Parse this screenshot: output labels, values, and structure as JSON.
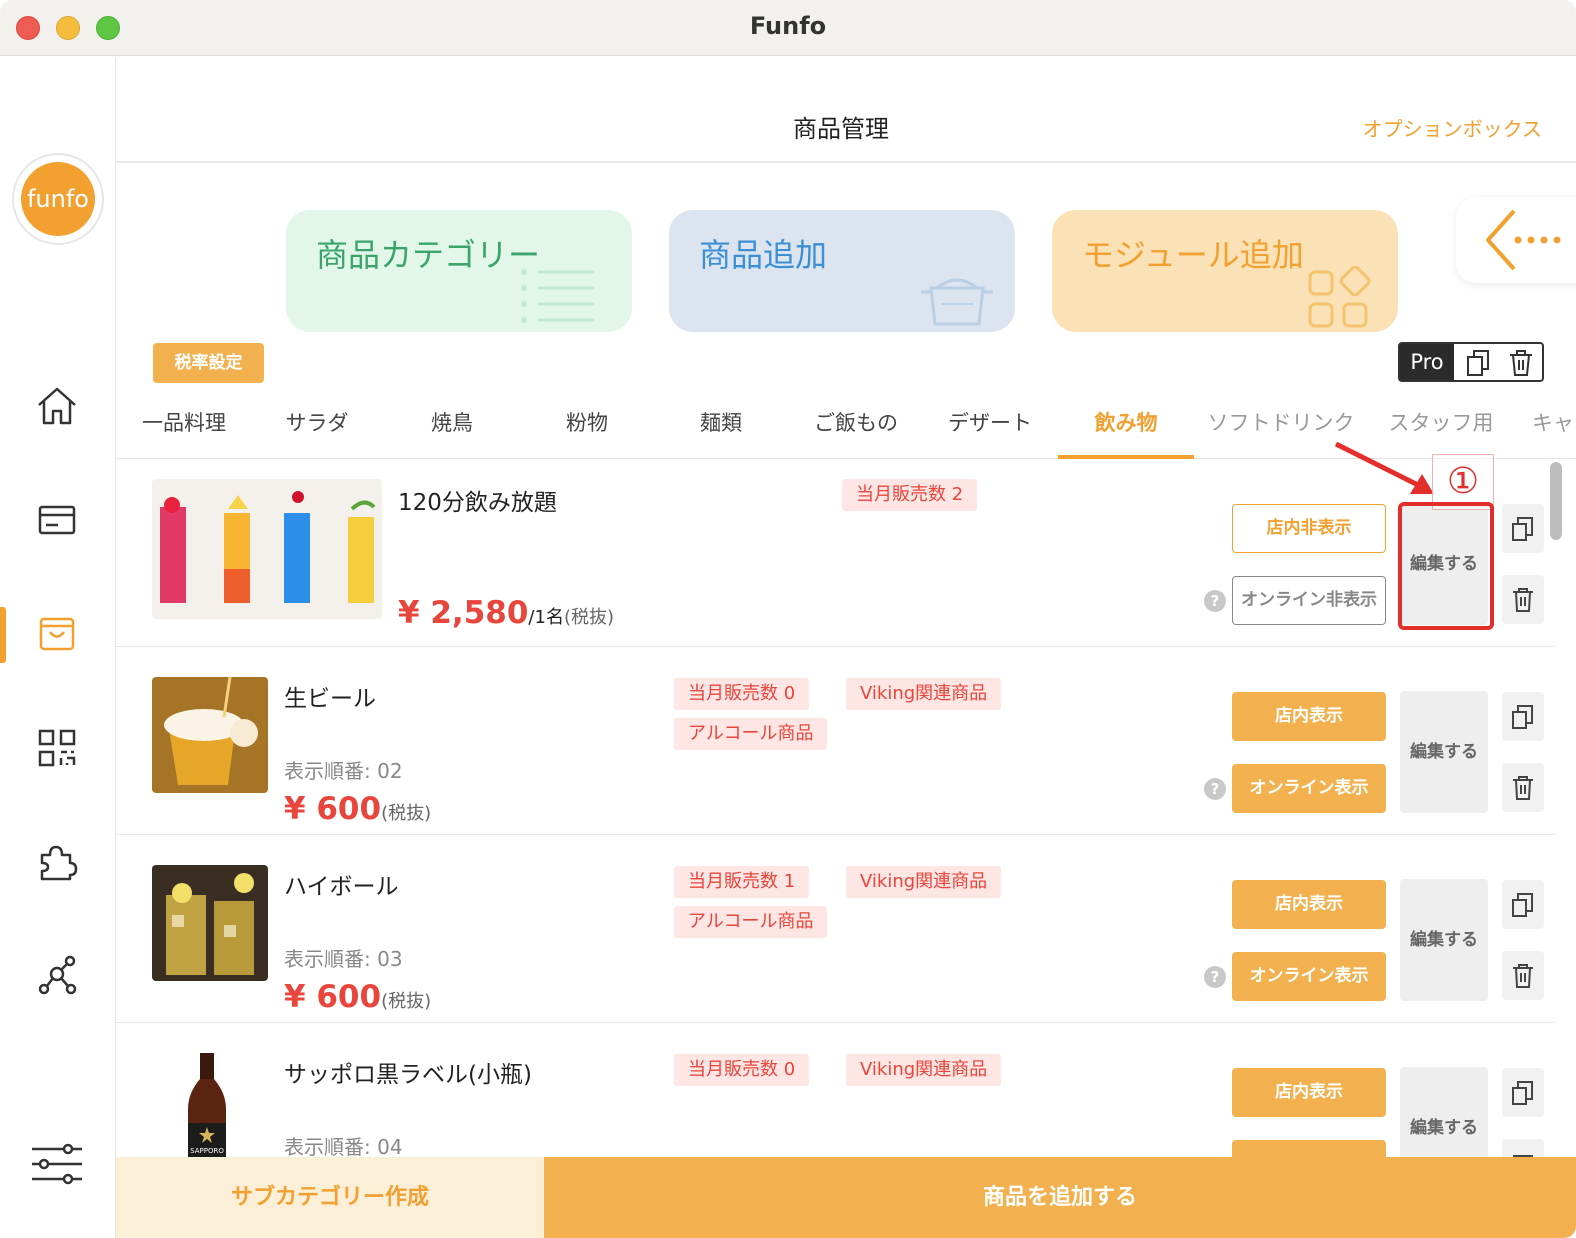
{
  "window": {
    "title": "Funfo"
  },
  "sidebar": {
    "logo_text": "funfo",
    "items": [
      {
        "icon": "home-icon"
      },
      {
        "icon": "card-icon"
      },
      {
        "icon": "shopping-bag-icon",
        "active": true
      },
      {
        "icon": "qr-code-icon"
      },
      {
        "icon": "puzzle-icon"
      },
      {
        "icon": "network-icon"
      },
      {
        "icon": "sliders-icon"
      }
    ],
    "accent": "#f2a030"
  },
  "header": {
    "title": "商品管理",
    "option_box": "オプションボックス"
  },
  "cards": [
    {
      "label": "商品カテゴリー",
      "icon": "list-icon"
    },
    {
      "label": "商品追加",
      "icon": "pot-icon"
    },
    {
      "label": "モジュール追加",
      "icon": "modules-icon"
    }
  ],
  "tax_button": "税率設定",
  "pro_label": "Pro",
  "tabs": [
    "一品料理",
    "サラダ",
    "焼鳥",
    "粉物",
    "麺類",
    "ご飯もの",
    "デザート",
    "飲み物",
    "ソフトドリンク",
    "スタッフ用",
    "キャ"
  ],
  "active_tab": "飲み物",
  "products": [
    {
      "name": "120分飲み放題",
      "order": "",
      "price": "¥ 2,580",
      "price_suffix": "/1名",
      "tax": "(税抜)",
      "tags": [
        "当月販売数 2"
      ],
      "store_button": "店内非表示",
      "online_button": "オンライン非表示",
      "edit": "編集する"
    },
    {
      "name": "生ビール",
      "order": "表示順番: 02",
      "price": "¥ 600",
      "tax": "(税抜)",
      "tags": [
        "当月販売数 0",
        "Viking関連商品",
        "アルコール商品"
      ],
      "store_button": "店内表示",
      "online_button": "オンライン表示",
      "edit": "編集する"
    },
    {
      "name": "ハイボール",
      "order": "表示順番: 03",
      "price": "¥ 600",
      "tax": "(税抜)",
      "tags": [
        "当月販売数 1",
        "Viking関連商品",
        "アルコール商品"
      ],
      "store_button": "店内表示",
      "online_button": "オンライン表示",
      "edit": "編集する"
    },
    {
      "name": "サッポロ黒ラベル(小瓶)",
      "order": "表示順番: 04",
      "tags": [
        "当月販売数 0",
        "Viking関連商品"
      ],
      "store_button": "店内表示",
      "edit": "編集する",
      "bottle_label": "SAPPORO"
    }
  ],
  "help_glyph": "?",
  "annotation": {
    "number": "①",
    "color": "#e22f2b"
  },
  "footer": {
    "left": "サブカテゴリー作成",
    "right": "商品を追加する"
  }
}
